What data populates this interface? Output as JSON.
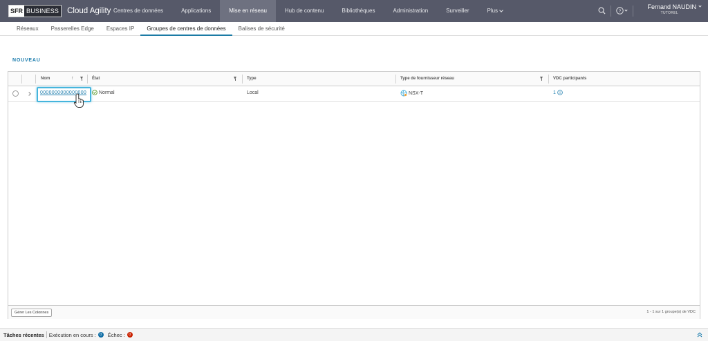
{
  "header": {
    "brand_sfr": "SFR",
    "brand_business": "BUSINESS",
    "app_name": "Cloud Agility",
    "nav": [
      {
        "label": "Centres de données"
      },
      {
        "label": "Applications"
      },
      {
        "label": "Mise en réseau"
      },
      {
        "label": "Hub de contenu"
      },
      {
        "label": "Bibliothèques"
      },
      {
        "label": "Administration"
      },
      {
        "label": "Surveiller"
      },
      {
        "label": "Plus"
      }
    ],
    "active_nav": "Mise en réseau",
    "user_name": "Fernand NAUDIN",
    "user_role": "TUTOREL"
  },
  "subnav": {
    "items": [
      {
        "label": "Réseaux"
      },
      {
        "label": "Passerelles Edge"
      },
      {
        "label": "Espaces IP"
      },
      {
        "label": "Groupes de centres de données"
      },
      {
        "label": "Balises de sécurité"
      }
    ],
    "active": "Groupes de centres de données"
  },
  "toolbar": {
    "new_label": "NOUVEAU"
  },
  "grid": {
    "columns": [
      "Nom",
      "État",
      "Type",
      "Type de fournisseur réseau",
      "VDC participants"
    ],
    "rows": [
      {
        "name": "0000000000000000",
        "state": "Normal",
        "type": "Local",
        "provider": "NSX-T",
        "vdc_count": "1"
      }
    ],
    "manage_columns_label": "Gérer Les Colonnes",
    "pagination": "1 - 1 sur 1 groupe(s) de VDC"
  },
  "taskbar": {
    "title": "Tâches récentes",
    "running_label": "Exécution en cours :",
    "running_count": "0",
    "failed_label": "Échec :",
    "failed_count": "0"
  },
  "colors": {
    "header_bg": "#565969",
    "accent": "#1b7cad",
    "highlight": "#45b5dd",
    "error": "#c92100"
  }
}
